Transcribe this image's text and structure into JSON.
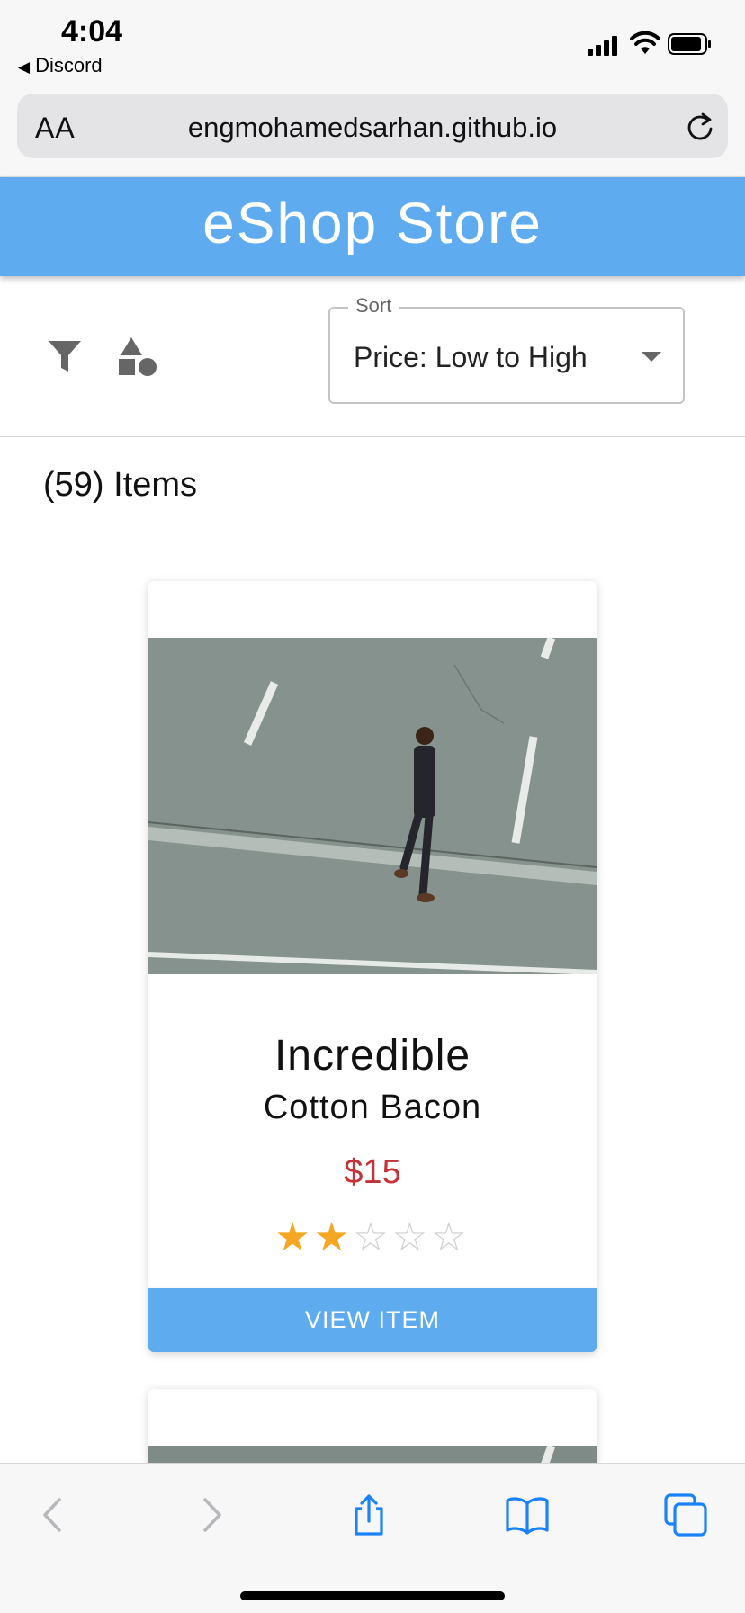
{
  "status": {
    "time": "4:04",
    "back_app": "Discord"
  },
  "browser": {
    "text_size_label": "AA",
    "url": "engmohamedsarhan.github.io"
  },
  "header": {
    "title": "eShop Store"
  },
  "toolbar": {
    "sort_label": "Sort",
    "sort_value": "Price: Low to High"
  },
  "listing": {
    "count_text": "(59) Items"
  },
  "products": [
    {
      "name_line1": "Incredible",
      "name_line2": "Cotton Bacon",
      "price": "$15",
      "rating": 2,
      "rating_max": 5,
      "button_label": "VIEW ITEM"
    }
  ],
  "colors": {
    "primary": "#5eacef",
    "price": "#c4323a",
    "star": "#f5a623",
    "safari_blue": "#1a82fb"
  },
  "icons": [
    "filter-icon",
    "shapes-icon",
    "reload-icon",
    "back-arrow-icon",
    "forward-arrow-icon",
    "share-icon",
    "bookmarks-icon",
    "tabs-icon"
  ]
}
